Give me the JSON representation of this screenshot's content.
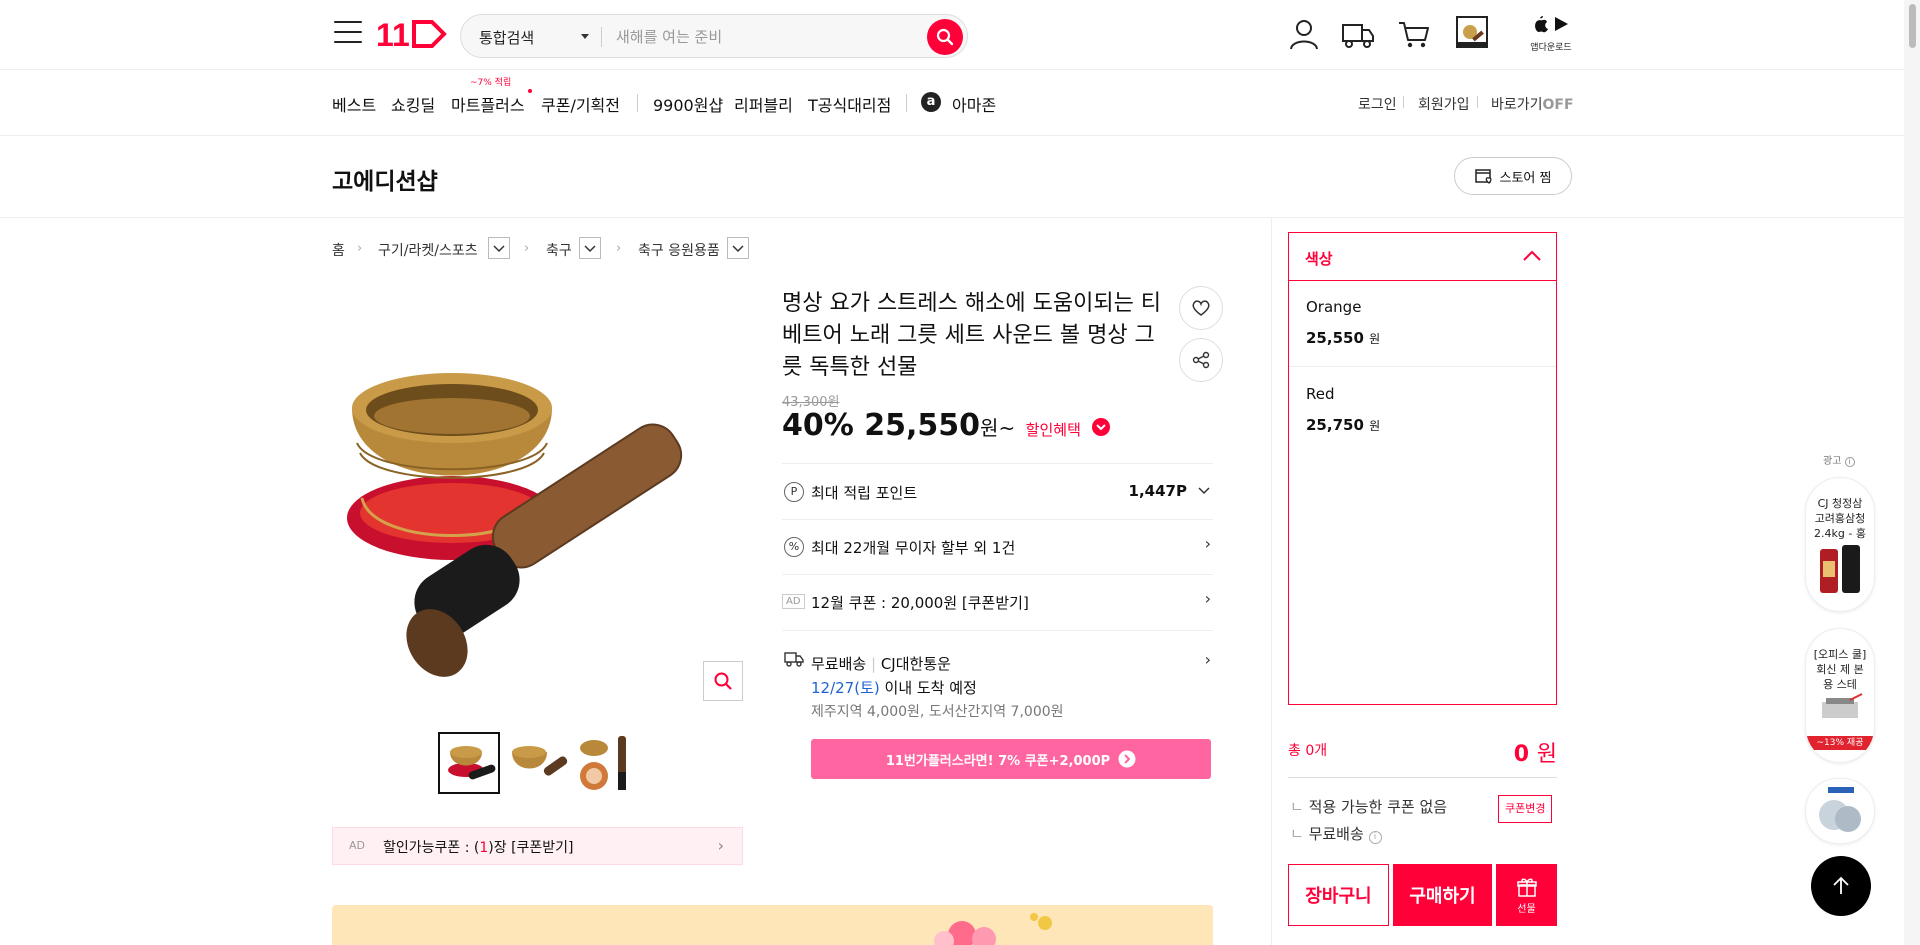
{
  "header": {
    "logo_text": "11",
    "search": {
      "category": "통합검색",
      "placeholder": "새해를 여는 준비"
    },
    "app_download": "앱다운로드"
  },
  "nav": {
    "items": [
      "베스트",
      "쇼킹딜",
      "마트플러스",
      "쿠폰/기획전",
      "9900원샵",
      "리퍼블리",
      "T공식대리점",
      "아마존"
    ],
    "mart_badge": "~7% 적립",
    "utils": {
      "login": "로그인",
      "signup": "회원가입",
      "shortcut": "바로가기",
      "shortcut_state": "OFF"
    }
  },
  "shop": {
    "name": "고에디션샵",
    "store_fav": "스토어 찜"
  },
  "breadcrumb": [
    "홈",
    "구기/라켓/스포츠",
    "축구",
    "축구 응원용품"
  ],
  "product": {
    "title": "명상 요가 스트레스 해소에 도움이되는 티베트어 노래 그릇 세트 사운드 볼 명상 그릇 독특한 선물",
    "original_price": "43,300원",
    "discount": "40%",
    "price": "25,550",
    "price_unit": "원~",
    "discount_benefit": "할인혜택",
    "rows": {
      "points_label": "최대 적립 포인트",
      "points_value": "1,447P",
      "installment": "최대 22개월 무이자 할부 외 1건",
      "coupon_ad_badge": "AD",
      "coupon_ad": "12월 쿠폰 : 20,000원 [쿠폰받기]",
      "shipping_free": "무료배송",
      "shipping_carrier": "CJ대한통운",
      "arrival_date": "12/27(토)",
      "arrival_text": "이내 도착 예정",
      "shipping_extra": "제주지역 4,000원, 도서산간지역 7,000원"
    },
    "plus_banner": "11번가플러스라면! 7% 쿠폰+2,000P",
    "coupon_bar": {
      "ad": "AD",
      "prefix": "할인가능쿠폰 : (",
      "count": "1",
      "suffix": ")장 [쿠폰받기]"
    }
  },
  "options": {
    "header": "색상",
    "items": [
      {
        "name": "Orange",
        "price": "25,550",
        "unit": "원"
      },
      {
        "name": "Red",
        "price": "25,750",
        "unit": "원"
      }
    ]
  },
  "order": {
    "total_count": "총 0개",
    "total_price": "0",
    "total_unit": "원",
    "coupon_none": "적용 가능한 쿠폰 없음",
    "coupon_change": "쿠폰변경",
    "free_shipping": "무료배송",
    "cart": "장바구니",
    "buy": "구매하기",
    "gift": "선물"
  },
  "ads": {
    "label": "광고",
    "card1": "CJ 청정삼 고려홍삼청 2.4kg - 홍",
    "card2": "[오피스 쿨] 회신 제 본용 스테",
    "card2_badge": "~13% 재공"
  },
  "colors": {
    "brand": "#ff0038",
    "plus_pink": "#ff65a0",
    "link_blue": "#1e64d2"
  }
}
